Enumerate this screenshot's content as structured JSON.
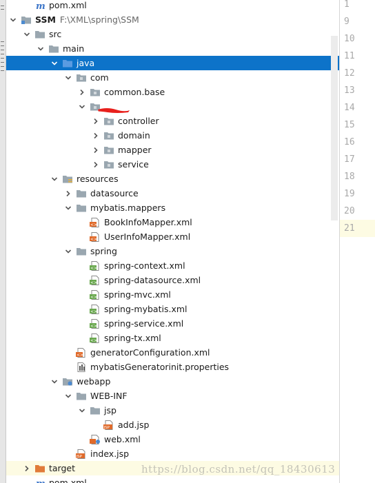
{
  "tree": {
    "rows": [
      {
        "label": "pom.xml",
        "sub": "",
        "icon": "maven-icon",
        "depth": 2,
        "arrow": "none"
      },
      {
        "label": "SSM",
        "sub": "F:\\XML\\spring\\SSM",
        "icon": "module-icon",
        "depth": 1,
        "arrow": "open",
        "bold": true
      },
      {
        "label": "src",
        "sub": "",
        "icon": "folder-icon",
        "depth": 2,
        "arrow": "open"
      },
      {
        "label": "main",
        "sub": "",
        "icon": "folder-icon",
        "depth": 3,
        "arrow": "open"
      },
      {
        "label": "java",
        "sub": "",
        "icon": "source-folder-icon",
        "depth": 4,
        "arrow": "open",
        "selected": true
      },
      {
        "label": "com",
        "sub": "",
        "icon": "package-icon",
        "depth": 5,
        "arrow": "open"
      },
      {
        "label": "common.base",
        "sub": "",
        "icon": "package-icon",
        "depth": 6,
        "arrow": "closed"
      },
      {
        "label": "",
        "sub": "",
        "icon": "package-icon",
        "depth": 6,
        "arrow": "open",
        "redacted": true
      },
      {
        "label": "controller",
        "sub": "",
        "icon": "package-icon",
        "depth": 7,
        "arrow": "closed"
      },
      {
        "label": "domain",
        "sub": "",
        "icon": "package-icon",
        "depth": 7,
        "arrow": "closed"
      },
      {
        "label": "mapper",
        "sub": "",
        "icon": "package-icon",
        "depth": 7,
        "arrow": "closed"
      },
      {
        "label": "service",
        "sub": "",
        "icon": "package-icon",
        "depth": 7,
        "arrow": "closed"
      },
      {
        "label": "resources",
        "sub": "",
        "icon": "resources-folder-icon",
        "depth": 4,
        "arrow": "open"
      },
      {
        "label": "datasource",
        "sub": "",
        "icon": "folder-icon",
        "depth": 5,
        "arrow": "closed"
      },
      {
        "label": "mybatis.mappers",
        "sub": "",
        "icon": "folder-icon",
        "depth": 5,
        "arrow": "open"
      },
      {
        "label": "BookInfoMapper.xml",
        "sub": "",
        "icon": "xml-file-icon",
        "depth": 6,
        "arrow": "none"
      },
      {
        "label": "UserInfoMapper.xml",
        "sub": "",
        "icon": "xml-file-icon",
        "depth": 6,
        "arrow": "none"
      },
      {
        "label": "spring",
        "sub": "",
        "icon": "folder-icon",
        "depth": 5,
        "arrow": "open"
      },
      {
        "label": "spring-context.xml",
        "sub": "",
        "icon": "spring-xml-icon",
        "depth": 6,
        "arrow": "none"
      },
      {
        "label": "spring-datasource.xml",
        "sub": "",
        "icon": "spring-xml-icon",
        "depth": 6,
        "arrow": "none"
      },
      {
        "label": "spring-mvc.xml",
        "sub": "",
        "icon": "spring-xml-icon",
        "depth": 6,
        "arrow": "none"
      },
      {
        "label": "spring-mybatis.xml",
        "sub": "",
        "icon": "spring-xml-icon",
        "depth": 6,
        "arrow": "none"
      },
      {
        "label": "spring-service.xml",
        "sub": "",
        "icon": "spring-xml-icon",
        "depth": 6,
        "arrow": "none"
      },
      {
        "label": "spring-tx.xml",
        "sub": "",
        "icon": "spring-xml-icon",
        "depth": 6,
        "arrow": "none"
      },
      {
        "label": "generatorConfiguration.xml",
        "sub": "",
        "icon": "xml-file-icon",
        "depth": 5,
        "arrow": "none"
      },
      {
        "label": "mybatisGeneratorinit.properties",
        "sub": "",
        "icon": "properties-file-icon",
        "depth": 5,
        "arrow": "none"
      },
      {
        "label": "webapp",
        "sub": "",
        "icon": "web-folder-icon",
        "depth": 4,
        "arrow": "open"
      },
      {
        "label": "WEB-INF",
        "sub": "",
        "icon": "folder-icon",
        "depth": 5,
        "arrow": "open"
      },
      {
        "label": "jsp",
        "sub": "",
        "icon": "folder-icon",
        "depth": 6,
        "arrow": "open"
      },
      {
        "label": "add.jsp",
        "sub": "",
        "icon": "jsp-file-icon",
        "depth": 7,
        "arrow": "none"
      },
      {
        "label": "web.xml",
        "sub": "",
        "icon": "web-xml-icon",
        "depth": 6,
        "arrow": "none"
      },
      {
        "label": "index.jsp",
        "sub": "",
        "icon": "jsp-file-icon",
        "depth": 5,
        "arrow": "none"
      },
      {
        "label": "target",
        "sub": "",
        "icon": "excluded-folder-icon",
        "depth": 2,
        "arrow": "closed",
        "target": true
      },
      {
        "label": "pom.xml",
        "sub": "",
        "icon": "maven-icon",
        "depth": 2,
        "arrow": "none"
      }
    ]
  },
  "gutter": {
    "lines": [
      "1",
      "9",
      "10",
      "11",
      "12",
      "13",
      "14",
      "15",
      "16",
      "17",
      "18",
      "19",
      "20",
      "21"
    ],
    "current_line": "21"
  },
  "watermark": "https://blog.csdn.net/qq_18430613",
  "colors": {
    "selection": "#0d73c9",
    "folder": "#9aa7b0",
    "source_folder": "#4c8ad0",
    "current_line": "#fdfbe3",
    "redaction": "#e8201c"
  }
}
